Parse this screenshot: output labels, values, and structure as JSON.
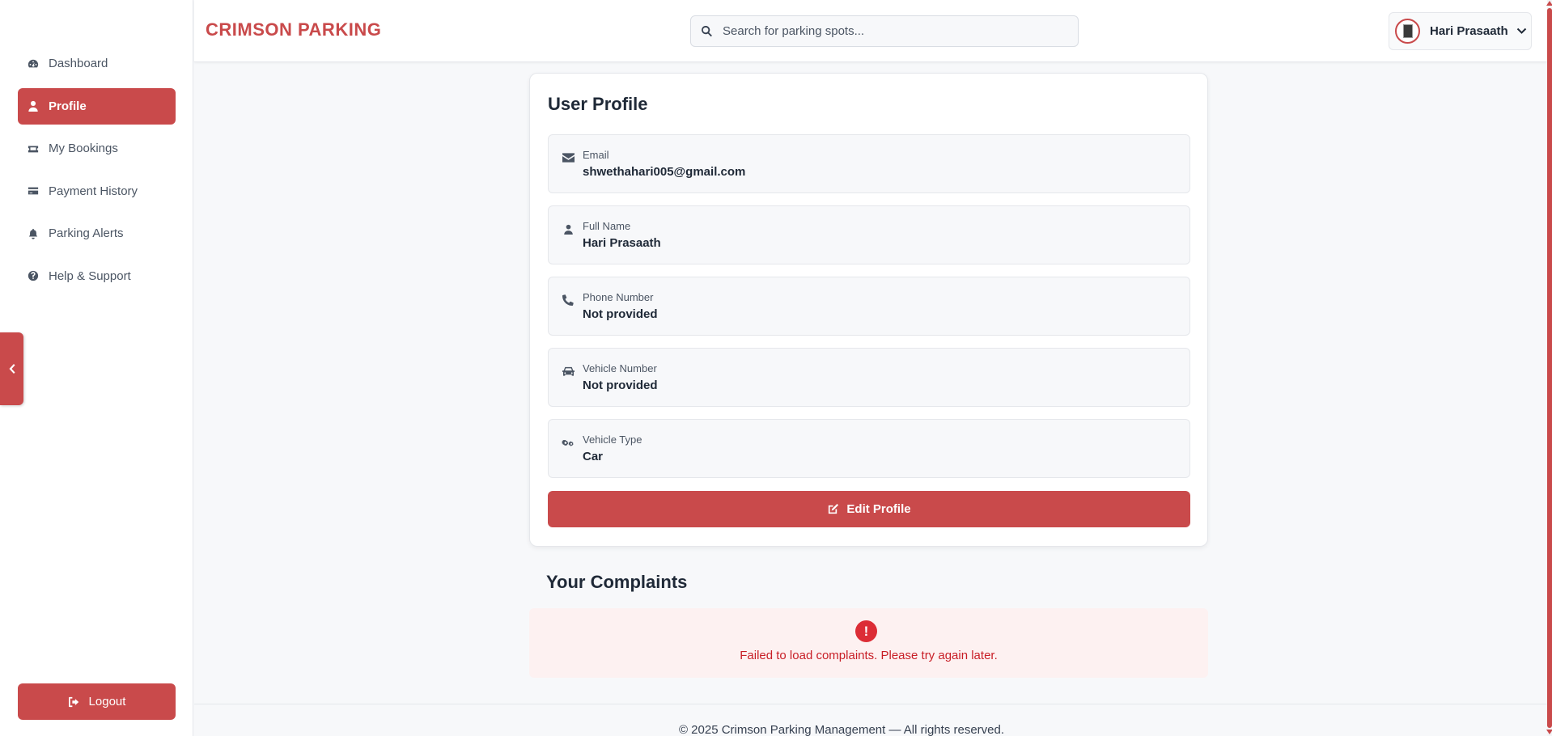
{
  "brand": {
    "name": "CRIMSON PARKING",
    "accent_color": "#c94a4b"
  },
  "search": {
    "placeholder": "Search for parking spots...",
    "value": ""
  },
  "user": {
    "name": "Hari Prasaath"
  },
  "sidebar": {
    "items": [
      {
        "label": "Dashboard",
        "icon": "dashboard-icon",
        "active": false
      },
      {
        "label": "Profile",
        "icon": "user-icon",
        "active": true
      },
      {
        "label": "My Bookings",
        "icon": "ticket-icon",
        "active": false
      },
      {
        "label": "Payment History",
        "icon": "credit-card-icon",
        "active": false
      },
      {
        "label": "Parking Alerts",
        "icon": "bell-icon",
        "active": false
      },
      {
        "label": "Help & Support",
        "icon": "question-circle-icon",
        "active": false
      }
    ],
    "logout_label": "Logout"
  },
  "profile": {
    "title": "User Profile",
    "fields": [
      {
        "label": "Email",
        "value": "shwethahari005@gmail.com",
        "icon": "envelope-icon"
      },
      {
        "label": "Full Name",
        "value": "Hari Prasaath",
        "icon": "user-icon"
      },
      {
        "label": "Phone Number",
        "value": "Not provided",
        "icon": "phone-icon"
      },
      {
        "label": "Vehicle Number",
        "value": "Not provided",
        "icon": "car-icon"
      },
      {
        "label": "Vehicle Type",
        "value": "Car",
        "icon": "cogs-icon"
      }
    ],
    "edit_label": "Edit Profile"
  },
  "complaints": {
    "title": "Your Complaints",
    "error_icon": "!",
    "error_message": "Failed to load complaints. Please try again later."
  },
  "footer": {
    "text": "© 2025 Crimson Parking Management — All rights reserved."
  }
}
